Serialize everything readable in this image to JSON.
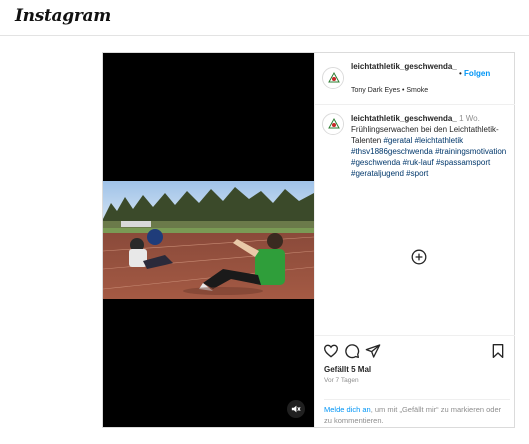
{
  "brand": {
    "name": "Instagram"
  },
  "post": {
    "username": "leichtathletik_geschwenda_",
    "follow_dot": "•",
    "follow_label": "Folgen",
    "audio": "Tony Dark Eyes • Smoke",
    "caption": {
      "username": "leichtathletik_geschwenda_",
      "time": "1 Wo.",
      "text": "Frühlingserwachen bei den Leichtathletik-Talenten",
      "hashtags": [
        "#geratal",
        "#leichtathletik",
        "#thsv1886geschwenda",
        "#trainingsmotivation",
        "#geschwenda",
        "#ruk-lauf",
        "#spassamsport",
        "#gerataljugend",
        "#sport"
      ]
    },
    "likes": "Gefällt 5 Mal",
    "posted_ago": "Vor 7 Tagen",
    "login_link": "Melde dich an",
    "login_rest": ", um mit „Gefällt mir“ zu markieren oder zu kommentieren."
  },
  "icons": {
    "mute": "speaker-muted-icon",
    "more_comments": "plus-circle-icon",
    "like": "heart-icon",
    "comment": "comment-bubble-icon",
    "share": "paper-plane-icon",
    "save": "bookmark-icon"
  },
  "colors": {
    "link_blue": "#0095f6",
    "hashtag_blue": "#00376b",
    "muted_text": "#8e8e8e",
    "border": "#dbdbdb"
  }
}
